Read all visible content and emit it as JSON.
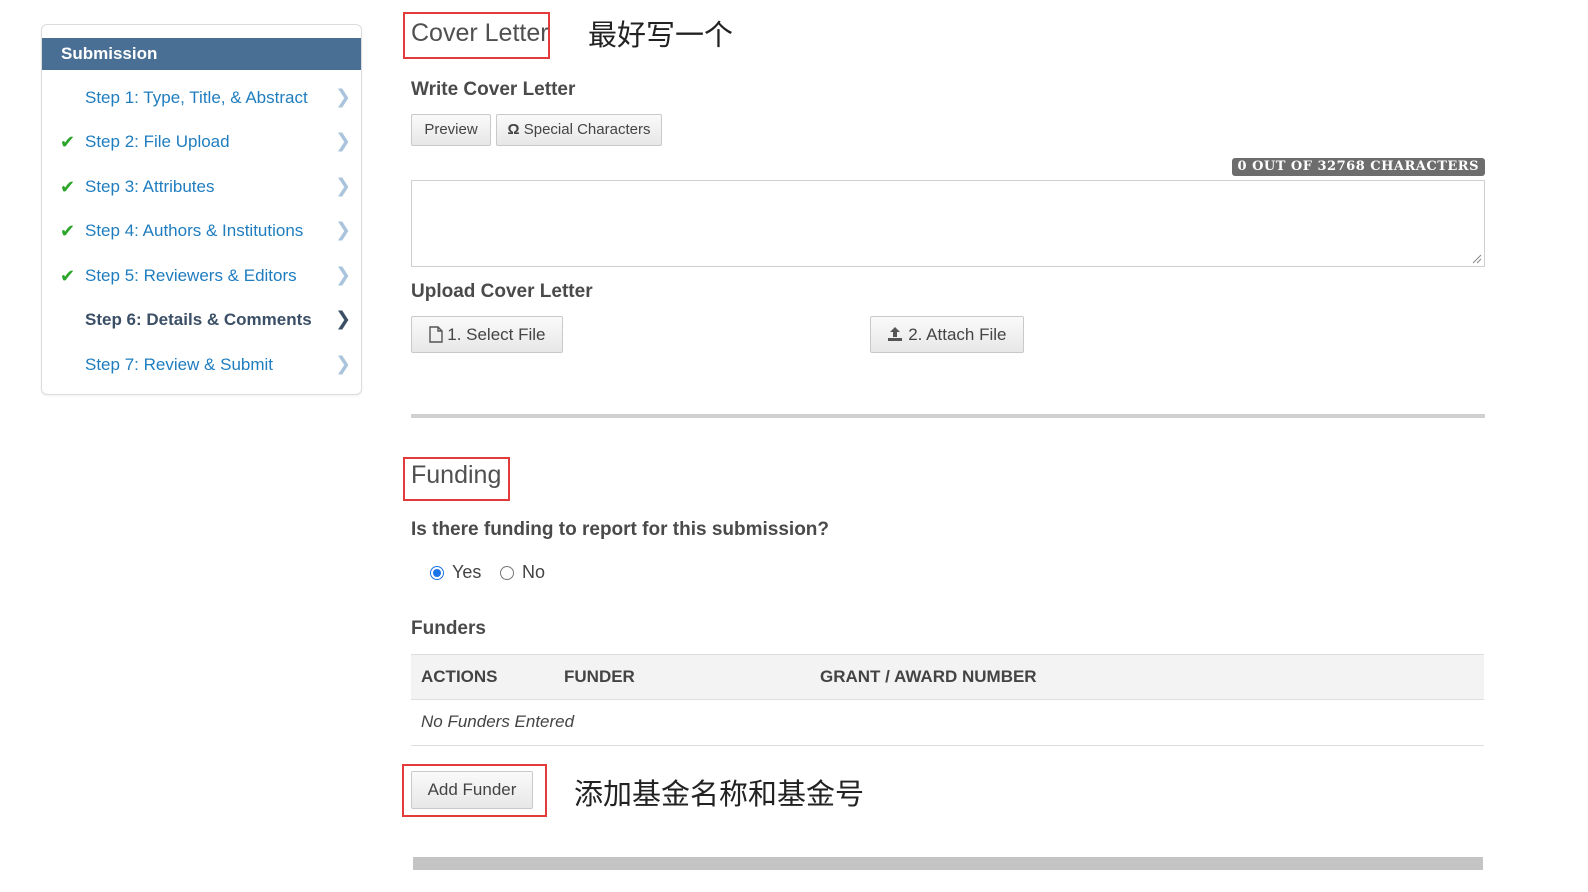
{
  "sidebar": {
    "title": "Submission",
    "steps": [
      {
        "label": "Step 1: Type, Title, & Abstract",
        "checked": false,
        "current": false
      },
      {
        "label": "Step 2: File Upload",
        "checked": true,
        "current": false
      },
      {
        "label": "Step 3: Attributes",
        "checked": true,
        "current": false
      },
      {
        "label": "Step 4: Authors & Institutions",
        "checked": true,
        "current": false
      },
      {
        "label": "Step 5: Reviewers & Editors",
        "checked": true,
        "current": false
      },
      {
        "label": "Step 6: Details & Comments",
        "checked": false,
        "current": true
      },
      {
        "label": "Step 7: Review & Submit",
        "checked": false,
        "current": false
      }
    ]
  },
  "cover_letter": {
    "title": "Cover Letter",
    "note": "最好写一个",
    "write_label": "Write Cover Letter",
    "preview_label": "Preview",
    "special_chars_label": "Special Characters",
    "char_count": "0 OUT OF 32768 CHARACTERS",
    "text_value": "",
    "upload_label": "Upload Cover Letter",
    "select_file_label": "1. Select File",
    "attach_file_label": "2. Attach File"
  },
  "funding": {
    "title": "Funding",
    "question": "Is there funding to report for this submission?",
    "options": [
      "Yes",
      "No"
    ],
    "selected": "Yes",
    "funders_label": "Funders",
    "columns": [
      "ACTIONS",
      "FUNDER",
      "GRANT / AWARD NUMBER"
    ],
    "empty_text": "No Funders Entered",
    "add_button": "Add Funder",
    "add_note": "添加基金名称和基金号"
  },
  "colors": {
    "sidebar_header": "#4a6f94",
    "link": "#1f7dbf",
    "check": "#2aa52a",
    "annotation": "#e23b3b",
    "radio": "#1a73e8"
  },
  "icons": {
    "step_status": "checkmark-icon",
    "step_arrow": "chevron-right-icon",
    "special_chars": "omega-icon",
    "select_file": "file-icon",
    "attach_file": "upload-icon"
  }
}
